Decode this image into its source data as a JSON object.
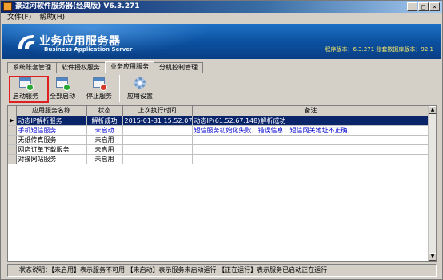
{
  "window": {
    "title": "豪过河软件服务器(经典版) V6.3.271",
    "buttons": [
      "_",
      "□",
      "×"
    ]
  },
  "menu": [
    "文件(F)",
    "帮助(H)"
  ],
  "banner": {
    "title": "业务应用服务器",
    "subtitle": "Business Application Server",
    "version_text": "程序版本：6.3.271   账套数据库版本：92.1"
  },
  "tabs": [
    {
      "label": "系统账套管理",
      "active": false
    },
    {
      "label": "软件授权服务",
      "active": false
    },
    {
      "label": "业务应用服务",
      "active": true
    },
    {
      "label": "分机控制管理",
      "active": false
    }
  ],
  "toolbar": {
    "start": "启动服务",
    "start_all": "全部启动",
    "stop": "停止服务",
    "settings": "应用设置"
  },
  "grid": {
    "columns": [
      "应用服务名称",
      "状态",
      "上次执行时间",
      "备注"
    ],
    "rows": [
      {
        "name": "动态IP解析服务",
        "status": "解析成功",
        "time": "2015-01-31 15:52:07",
        "note": "动态IP(61.52.67.148)解析成功",
        "selected": true
      },
      {
        "name": "手机短信服务",
        "status": "未启动",
        "time": "",
        "note": "短信服务初始化失败，错误信息：短信网关地址不正确，",
        "selected": false
      },
      {
        "name": "无纸传真服务",
        "status": "未启用",
        "time": "",
        "note": "",
        "selected": false
      },
      {
        "name": "网店订单下载服务",
        "status": "未启用",
        "time": "",
        "note": "",
        "selected": false
      },
      {
        "name": "对接网站服务",
        "status": "未启用",
        "time": "",
        "note": "",
        "selected": false
      }
    ]
  },
  "status_bar": "状态说明：【未启用】表示服务不可用  【未启动】表示服务未启动运行  【正在运行】表示服务已启动正在运行"
}
